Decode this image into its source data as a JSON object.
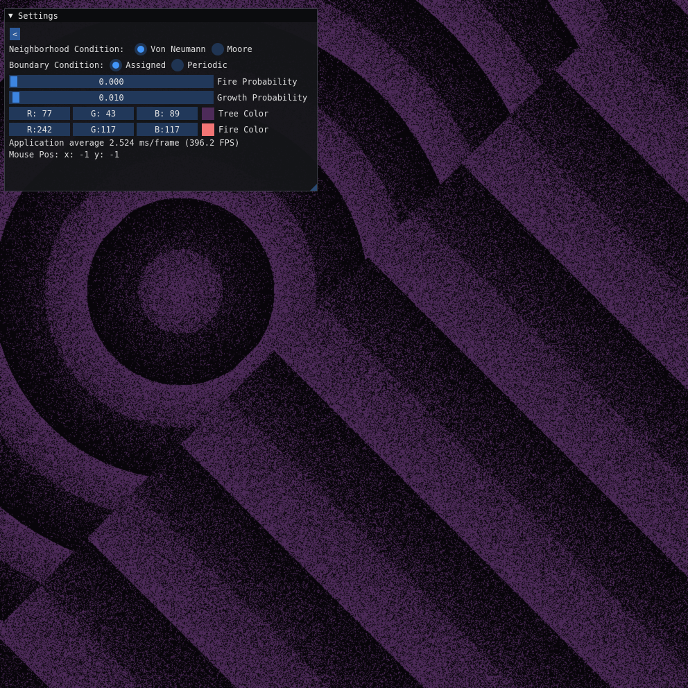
{
  "window": {
    "title": "Settings",
    "collapse_arrow": "▼"
  },
  "collapse_button": {
    "label": "<"
  },
  "neighborhood": {
    "label": "Neighborhood Condition:",
    "options": [
      {
        "label": "Von Neumann",
        "selected": true
      },
      {
        "label": "Moore",
        "selected": false
      }
    ]
  },
  "boundary": {
    "label": "Boundary Condition:",
    "options": [
      {
        "label": "Assigned",
        "selected": true
      },
      {
        "label": "Periodic",
        "selected": false
      }
    ]
  },
  "fire_probability": {
    "value": "0.000",
    "fraction": 0.0,
    "label": "Fire Probability"
  },
  "growth_probability": {
    "value": "0.010",
    "fraction": 0.01,
    "label": "Growth Probability"
  },
  "tree_color": {
    "r": "R: 77",
    "g": "G: 43",
    "b": "B: 89",
    "hex": "#4d2b59",
    "label": "Tree Color"
  },
  "fire_color": {
    "r": "R:242",
    "g": "G:117",
    "b": "B:117",
    "hex": "#f27575",
    "label": "Fire Color"
  },
  "stats": {
    "framerate": "Application average 2.524 ms/frame (396.2 FPS)",
    "mouse": "Mouse Pos: x: -1 y: -1"
  }
}
